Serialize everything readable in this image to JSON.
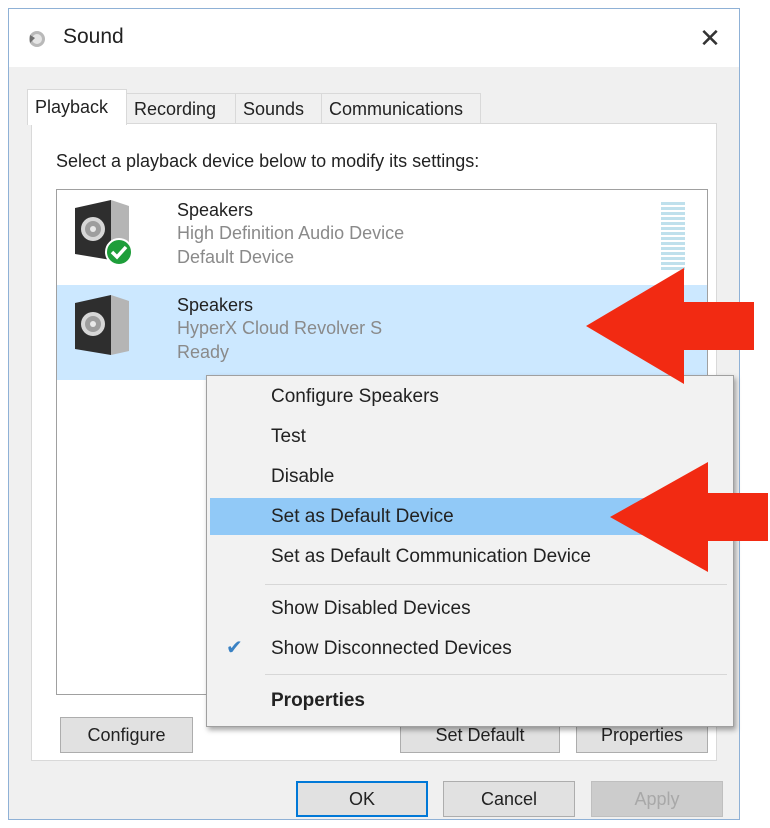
{
  "window": {
    "title": "Sound",
    "close_glyph": "✕"
  },
  "tabs": [
    {
      "label": "Playback",
      "active": true
    },
    {
      "label": "Recording",
      "active": false
    },
    {
      "label": "Sounds",
      "active": false
    },
    {
      "label": "Communications",
      "active": false
    }
  ],
  "instruction": "Select a playback device below to modify its settings:",
  "devices": [
    {
      "name": "Speakers",
      "description": "High Definition Audio Device",
      "status": "Default Device",
      "icon": "speaker-icon",
      "badge": "default-check-icon",
      "selected": false
    },
    {
      "name": "Speakers",
      "description": "HyperX Cloud Revolver S",
      "status": "Ready",
      "icon": "speaker-icon",
      "selected": true
    }
  ],
  "buttons": {
    "configure": "Configure",
    "set_default": "Set Default",
    "properties": "Properties",
    "ok": "OK",
    "cancel": "Cancel",
    "apply": "Apply"
  },
  "context_menu": {
    "items": [
      {
        "label": "Configure Speakers"
      },
      {
        "label": "Test"
      },
      {
        "label": "Disable"
      },
      {
        "label": "Set as Default Device",
        "highlighted": true
      },
      {
        "label": "Set as Default Communication Device"
      },
      {
        "label": "Show Disabled Devices"
      },
      {
        "label": "Show Disconnected Devices",
        "checked": true
      },
      {
        "label": "Properties",
        "bold": true
      }
    ]
  },
  "colors": {
    "selection": "#cce8ff",
    "menu_highlight": "#91c9f7",
    "annotation_arrow": "#f22a12",
    "default_badge": "#1e9e3a"
  }
}
